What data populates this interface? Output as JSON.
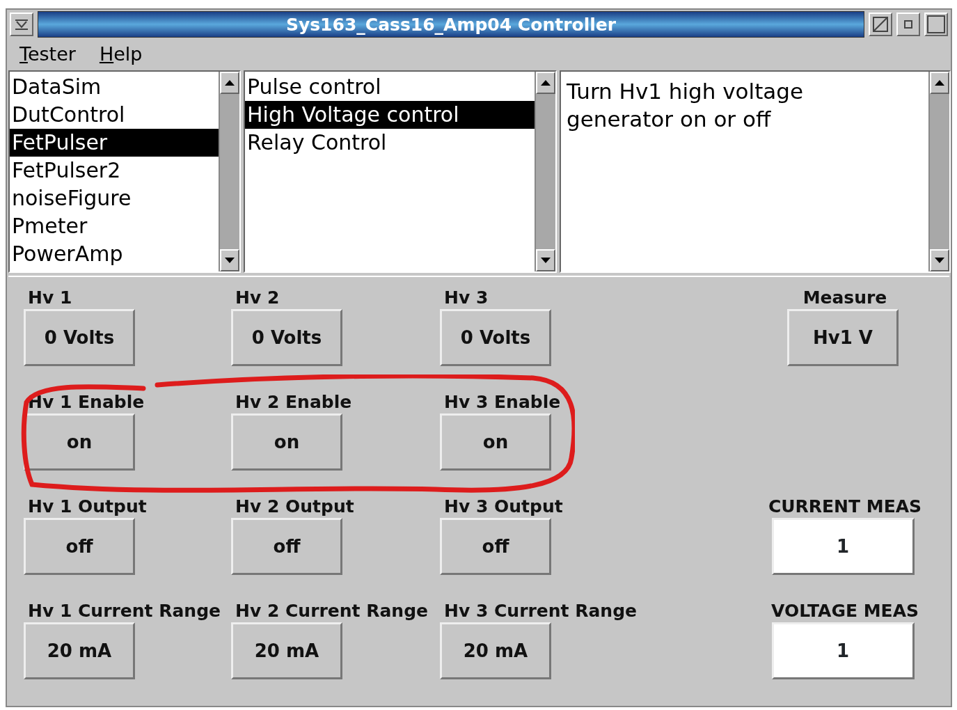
{
  "window": {
    "title": "Sys163_Cass16_Amp04 Controller"
  },
  "menu": [
    {
      "label": "Tester",
      "underlined_initial": true
    },
    {
      "label": "Help",
      "underlined_initial": true
    }
  ],
  "modules": [
    {
      "label": "DataSim",
      "selected": false
    },
    {
      "label": "DutControl",
      "selected": false
    },
    {
      "label": "FetPulser",
      "selected": true
    },
    {
      "label": "FetPulser2",
      "selected": false
    },
    {
      "label": "noiseFigure",
      "selected": false
    },
    {
      "label": "Pmeter",
      "selected": false
    },
    {
      "label": "PowerAmp",
      "selected": false
    }
  ],
  "commands": [
    {
      "label": "Pulse control",
      "selected": false
    },
    {
      "label": "High Voltage control",
      "selected": true
    },
    {
      "label": "Relay Control",
      "selected": false
    }
  ],
  "description": "Turn Hv1 high voltage generator on or off",
  "controls": [
    {
      "cells": [
        {
          "label": "Hv 1",
          "value": "0  Volts",
          "kind": "button"
        },
        {
          "label": "Hv 2",
          "value": "0  Volts",
          "kind": "button"
        },
        {
          "label": "Hv 3",
          "value": "0  Volts",
          "kind": "button"
        },
        {
          "label": "Measure",
          "value": "Hv1 V",
          "kind": "button"
        }
      ]
    },
    {
      "cells": [
        {
          "label": "Hv 1 Enable",
          "value": "on",
          "kind": "button"
        },
        {
          "label": "Hv 2 Enable",
          "value": "on",
          "kind": "button"
        },
        {
          "label": "Hv 3 Enable",
          "value": "on",
          "kind": "button"
        },
        null
      ]
    },
    {
      "cells": [
        {
          "label": "Hv 1 Output",
          "value": "off",
          "kind": "button"
        },
        {
          "label": "Hv 2 Output",
          "value": "off",
          "kind": "button"
        },
        {
          "label": "Hv 3 Output",
          "value": "off",
          "kind": "button"
        },
        {
          "label": "CURRENT MEAS",
          "value": "1",
          "kind": "display"
        }
      ]
    },
    {
      "cells": [
        {
          "label": "Hv 1 Current Range",
          "value": "20 mA",
          "kind": "button"
        },
        {
          "label": "Hv 2 Current Range",
          "value": "20 mA",
          "kind": "button"
        },
        {
          "label": "Hv 3 Current Range",
          "value": "20 mA",
          "kind": "button"
        },
        {
          "label": "VOLTAGE MEAS",
          "value": "1",
          "kind": "display"
        }
      ]
    }
  ]
}
